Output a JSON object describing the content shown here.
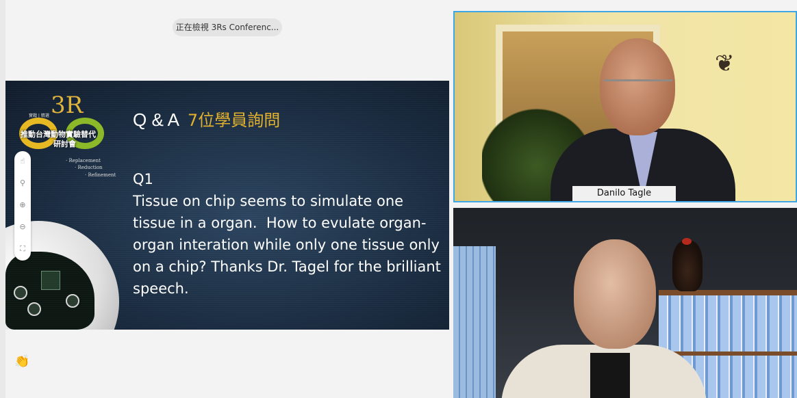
{
  "viewing_banner": "正在檢視 3Rs Conferenc...",
  "slide": {
    "logo_3r": "3R",
    "logo_small": "實戰 | 精選",
    "logo_cn_line1": "推動台灣動物實驗替代",
    "logo_cn_line2": "研討會",
    "tagline": [
      "· Replacement",
      "· Reduction",
      "· Refinement"
    ],
    "title_left": "Q & A",
    "title_right": "7位學員詢問",
    "body": "Q1\nTissue on chip seems to simulate one tissue in a organ.  How to evulate organ-organ interation while only one tissue only on a chip? Thanks Dr. Tagel for the brilliant speech.",
    "colors": {
      "background": "#1b2d42",
      "title_accent": "#e2b12c"
    }
  },
  "toolbar": {
    "tools": [
      {
        "icon": "hand-icon",
        "glyph": "☝"
      },
      {
        "icon": "cursor-icon",
        "glyph": "⚲"
      },
      {
        "icon": "zoom-in-icon",
        "glyph": "⊕"
      },
      {
        "icon": "zoom-out-icon",
        "glyph": "⊖"
      },
      {
        "icon": "fit-screen-icon",
        "glyph": "⛶"
      }
    ]
  },
  "reaction": {
    "icon": "clapping-hands-icon",
    "glyph": "👏"
  },
  "participants": [
    {
      "name": "Danilo Tagle",
      "active_speaker": true
    },
    {
      "name": "",
      "active_speaker": false
    }
  ],
  "colors": {
    "active_border": "#3fa6e6"
  }
}
